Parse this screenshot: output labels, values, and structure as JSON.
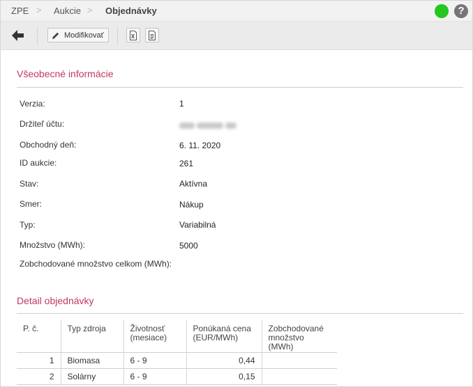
{
  "breadcrumb": {
    "items": [
      "ZPE",
      "Aukcie",
      "Objednávky"
    ],
    "separator": ">"
  },
  "status": {
    "color": "#22c71f"
  },
  "help": {
    "symbol": "?"
  },
  "toolbar": {
    "modify_label": "Modifikovať",
    "export_excel_icon": "excel-icon",
    "export_doc_icon": "document-icon"
  },
  "general": {
    "title": "Všeobecné informácie",
    "fields": [
      {
        "label": "Verzia:",
        "value": "1"
      },
      {
        "label": "Držiteľ účtu:",
        "value": ""
      },
      {
        "label": "Obchodný deň:",
        "value": "6. 11. 2020"
      },
      {
        "label": "ID aukcie:",
        "value": "261"
      },
      {
        "label": "Stav:",
        "value": "Aktívna"
      },
      {
        "label": "Smer:",
        "value": "Nákup"
      },
      {
        "label": "Typ:",
        "value": "Variabilná"
      },
      {
        "label": "Množstvo (MWh):",
        "value": "5000"
      },
      {
        "label": "Zobchodované množstvo celkom (MWh):",
        "value": ""
      }
    ]
  },
  "detail": {
    "title": "Detail objednávky",
    "columns": [
      "P. č.",
      "Typ zdroja",
      "Životnosť (mesiace)",
      "Ponúkaná cena (EUR/MWh)",
      "Zobchodované množstvo (MWh)"
    ],
    "rows": [
      {
        "no": "1",
        "source": "Biomasa",
        "lifetime": "6 - 9",
        "price": "0,44",
        "traded": ""
      },
      {
        "no": "2",
        "source": "Solárny",
        "lifetime": "6 - 9",
        "price": "0,15",
        "traded": ""
      }
    ]
  },
  "colors": {
    "accent": "#c0395e",
    "status_ok": "#22c71f"
  }
}
